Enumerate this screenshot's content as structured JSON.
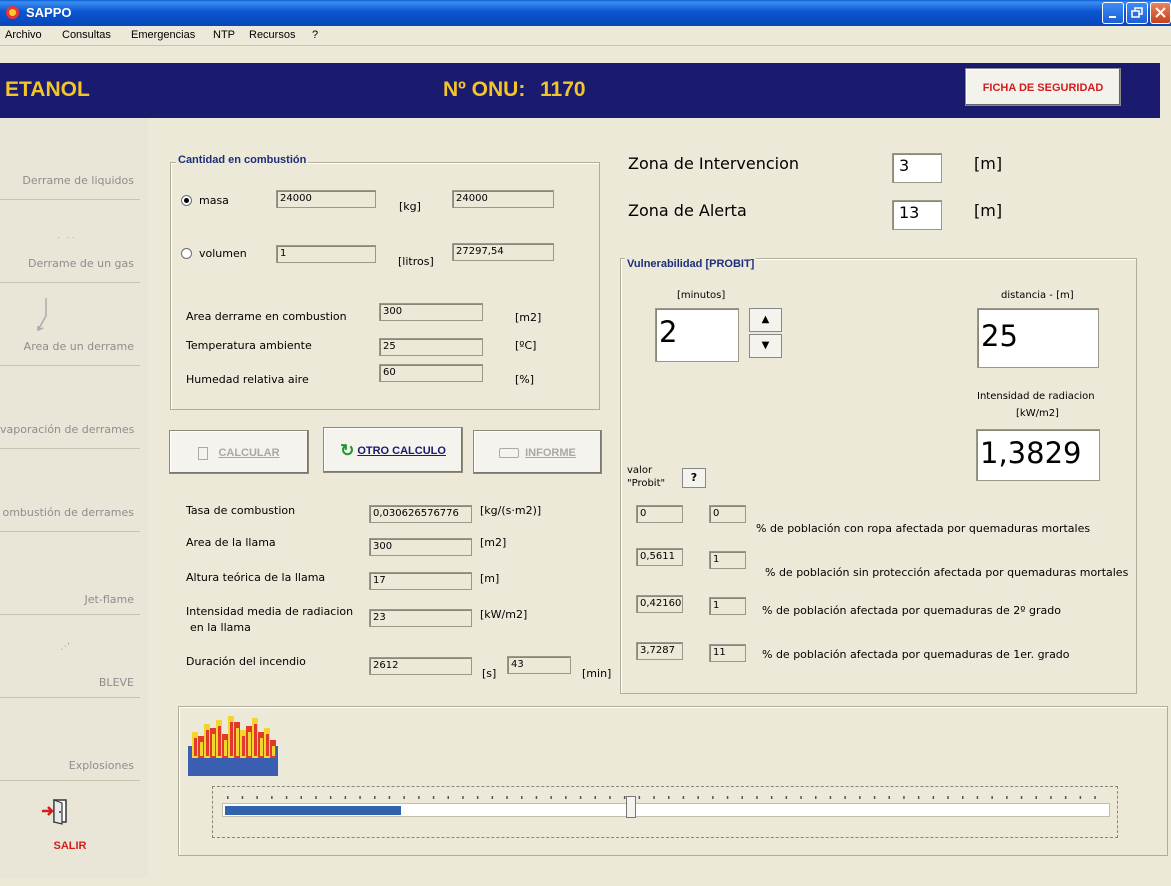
{
  "window": {
    "title": "SAPPO"
  },
  "menu": [
    "Archivo",
    "Consultas",
    "Emergencias",
    "NTP",
    "Recursos",
    "?"
  ],
  "header": {
    "substance": "ETANOL",
    "onu_label": "Nº ONU:",
    "onu_number": "1170",
    "ficha_button": "FICHA DE SEGURIDAD"
  },
  "sidebar": {
    "items": [
      {
        "label": "Derrame de liquidos",
        "icon": ""
      },
      {
        "label": "Derrame de un gas",
        "icon": "gas-icon"
      },
      {
        "label": "Area de un derrame",
        "icon": "spill-icon"
      },
      {
        "label": "vaporación de derrames",
        "icon": ""
      },
      {
        "label": "ombustión de derrames",
        "icon": ""
      },
      {
        "label": "Jet-flame",
        "icon": ""
      },
      {
        "label": "BLEVE",
        "icon": "bleve-icon"
      },
      {
        "label": "Explosiones",
        "icon": ""
      }
    ],
    "salir_label": "SALIR"
  },
  "cantidad": {
    "title": "Cantidad en combustión",
    "masa_label": "masa",
    "masa_value": "24000",
    "masa_unit": "[kg]",
    "masa_result": "24000",
    "volumen_label": "volumen",
    "volumen_value": "1",
    "volumen_unit": "[litros]",
    "volumen_result": "27297,54",
    "area_label": "Area derrame en combustion",
    "area_value": "300",
    "area_unit": "[m2]",
    "temp_label": "Temperatura ambiente",
    "temp_value": "25",
    "temp_unit": "[ºC]",
    "hum_label": "Humedad relativa aire",
    "hum_value": "60",
    "hum_unit": "[%]"
  },
  "buttons": {
    "calcular": "CALCULAR",
    "otro": "OTRO CALCULO",
    "informe": "INFORME"
  },
  "results": {
    "tasa_label": "Tasa de combustion",
    "tasa_value": "0,030626576776",
    "tasa_unit": "[kg/(s·m2)]",
    "area_llama_label": "Area de la llama",
    "area_llama_value": "300",
    "area_llama_unit": "[m2]",
    "altura_label": "Altura teórica de la llama",
    "altura_value": "17",
    "altura_unit": "[m]",
    "intensidad_label_1": "Intensidad media de radiacion",
    "intensidad_label_2": "en la llama",
    "intensidad_value": "23",
    "intensidad_unit": "[kW/m2]",
    "duracion_label": "Duración del incendio",
    "duracion_s": "2612",
    "duracion_s_unit": "[s]",
    "duracion_min": "43",
    "duracion_min_unit": "[min]"
  },
  "zonas": {
    "intervencion_label": "Zona de Intervencion",
    "intervencion_value": "3",
    "intervencion_unit": "[m]",
    "alerta_label": "Zona de Alerta",
    "alerta_value": "13",
    "alerta_unit": "[m]"
  },
  "probit": {
    "title": "Vulnerabilidad [PROBIT]",
    "minutos_label": "[minutos]",
    "minutos_value": "2",
    "distancia_label": "distancia - [m]",
    "distancia_value": "25",
    "intensidad_label_1": "Intensidad de radiacion",
    "intensidad_label_2": "[kW/m2]",
    "intensidad_value": "1,3829",
    "valor_label_1": "valor",
    "valor_label_2": "\"Probit\"",
    "help": "?",
    "rows": [
      {
        "probit": "0",
        "pct": "0",
        "label": "% de población con ropa afectada por quemaduras mortales"
      },
      {
        "probit": "0,5611",
        "pct": "1",
        "label": "% de población sin protección afectada por quemaduras mortales"
      },
      {
        "probit": "0,42160",
        "pct": "1",
        "label": "% de población afectada por quemaduras de 2º grado"
      },
      {
        "probit": "3,7287",
        "pct": "11",
        "label": "% de población afectada por quemaduras de 1er. grado"
      }
    ]
  },
  "progress": {
    "fraction": 0.2
  }
}
